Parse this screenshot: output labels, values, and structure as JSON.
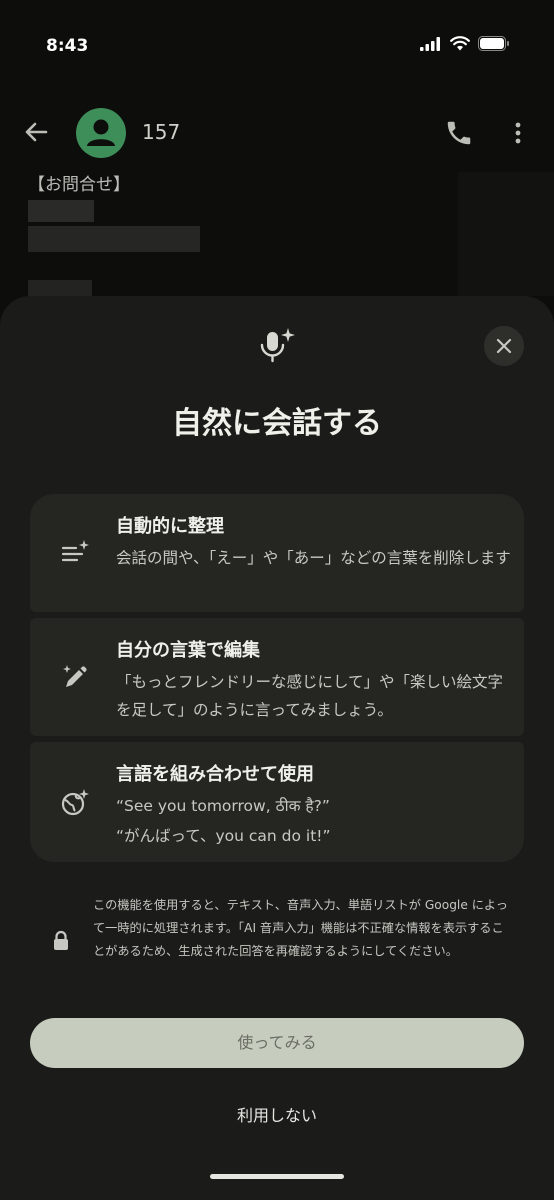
{
  "status_bar": {
    "time": "8:43",
    "icons": [
      "signal-icon",
      "wifi-icon",
      "battery-icon"
    ]
  },
  "chat_header": {
    "contact_name": "157",
    "icons": [
      "back-arrow-icon",
      "avatar-person-icon",
      "phone-icon",
      "more-vert-icon"
    ],
    "avatar_color": "#3e8e5a"
  },
  "background_message": {
    "heading": "【お問合せ】"
  },
  "sheet": {
    "title": "自然に会話する",
    "header_icon": "mic-sparkle-icon",
    "close_icon": "close-icon",
    "features": [
      {
        "icon": "auto-format-icon",
        "title": "自動的に整理",
        "description": "会話の間や、「えー」や「あー」などの言葉を削除します"
      },
      {
        "icon": "magic-pen-icon",
        "title": "自分の言葉で編集",
        "description": "「もっとフレンドリーな感じにして」や「楽しい絵文字を足して」のように言ってみましょう。"
      },
      {
        "icon": "globe-sparkle-icon",
        "title": "言語を組み合わせて使用",
        "description_line1": "“See you tomorrow, ठीक है?”",
        "description_line2": "“がんばって、you can do it!”"
      }
    ],
    "disclaimer": "この機能を使用すると、テキスト、音声入力、単語リストが Google によって一時的に処理されます。「AI 音声入力」機能は不正確な情報を表示することがあるため、生成された回答を再確認するようにしてください。",
    "disclaimer_icon": "lock-icon",
    "primary_button": "使ってみる",
    "secondary_button": "利用しない"
  },
  "colors": {
    "background": "#0d0e0b",
    "sheet": "#1b1c19",
    "card": "#252622",
    "primary_button": "#c6cdbf"
  }
}
